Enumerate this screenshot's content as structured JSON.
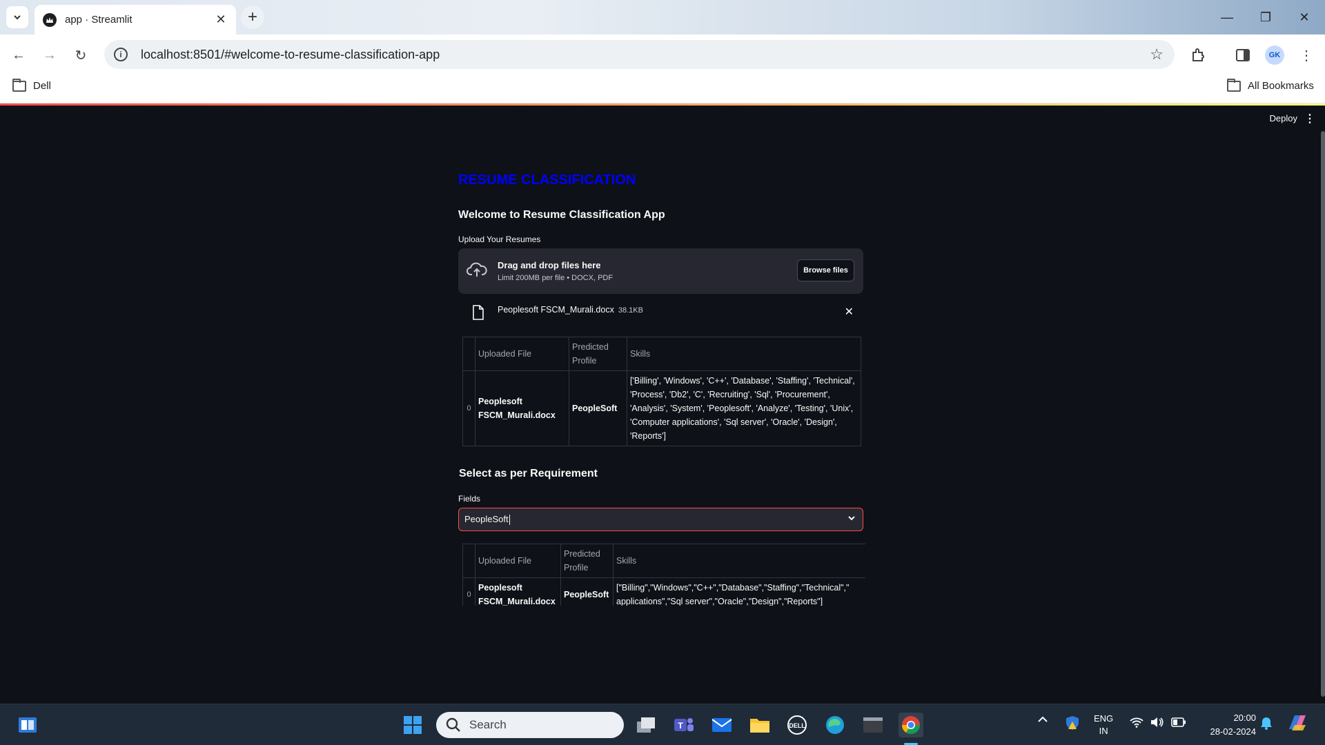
{
  "browser": {
    "tab_title": "app · Streamlit",
    "url": "localhost:8501/#welcome-to-resume-classification-app",
    "bookmarks": [
      "Dell"
    ],
    "all_bookmarks_label": "All Bookmarks",
    "profile_initials": "GK"
  },
  "streamlit": {
    "deploy_label": "Deploy",
    "page_title": "RESUME CLASSIFICATION",
    "welcome": "Welcome to Resume Classification App",
    "upload_label": "Upload Your Resumes",
    "dropzone_main": "Drag and drop files here",
    "dropzone_sub": "Limit 200MB per file • DOCX, PDF",
    "browse_label": "Browse files",
    "uploaded_file": {
      "name": "Peoplesoft FSCM_Murali.docx",
      "size": "38.1KB"
    },
    "table1": {
      "headers": [
        "",
        "Uploaded File",
        "Predicted Profile",
        "Skills"
      ],
      "rows": [
        {
          "index": "0",
          "file": "Peoplesoft FSCM_Murali.docx",
          "profile": "PeopleSoft",
          "skills": "['Billing', 'Windows', 'C++', 'Database', 'Staffing', 'Technical', 'Process', 'Db2', 'C', 'Recruiting', 'Sql', 'Procurement', 'Analysis', 'System', 'Peoplesoft', 'Analyze', 'Testing', 'Unix', 'Computer applications', 'Sql server', 'Oracle', 'Design', 'Reports']"
        }
      ]
    },
    "select_heading": "Select as per Requirement",
    "fields_label": "Fields",
    "fields_value": "PeopleSoft",
    "table2": {
      "headers": [
        "",
        "Uploaded File",
        "Predicted Profile",
        "Skills"
      ],
      "rows": [
        {
          "index": "0",
          "file": "Peoplesoft FSCM_Murali.docx",
          "profile": "PeopleSoft",
          "skills_line1": "[\"Billing\",\"Windows\",\"C++\",\"Database\",\"Staffing\",\"Technical\",\"",
          "skills_line2": "applications\",\"Sql server\",\"Oracle\",\"Design\",\"Reports\"]"
        }
      ]
    }
  },
  "taskbar": {
    "search_placeholder": "Search",
    "lang_line1": "ENG",
    "lang_line2": "IN",
    "time": "20:00",
    "date": "28-02-2024"
  }
}
